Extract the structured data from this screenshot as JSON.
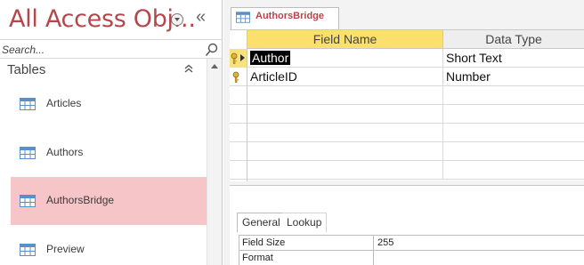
{
  "nav": {
    "title": "All Access Obj...",
    "collapse_glyph": "«",
    "search_placeholder": "Search...",
    "group_label": "Tables",
    "group_chevron": "⌃⌃",
    "items": [
      {
        "label": "Articles",
        "icon": "table-icon",
        "selected": false
      },
      {
        "label": "Authors",
        "icon": "table-icon",
        "selected": false
      },
      {
        "label": "AuthorsBridge",
        "icon": "table-icon",
        "selected": true
      },
      {
        "label": "Preview",
        "icon": "table-icon",
        "selected": false
      }
    ]
  },
  "tab": {
    "label": "AuthorsBridge",
    "icon": "table-icon"
  },
  "design_grid": {
    "headers": {
      "field_name": "Field Name",
      "data_type": "Data Type"
    },
    "rows": [
      {
        "field_name": "Author",
        "data_type": "Short Text",
        "primary_key": true,
        "current": true
      },
      {
        "field_name": "ArticleID",
        "data_type": "Number",
        "primary_key": true,
        "current": false
      }
    ]
  },
  "properties": {
    "tabs": [
      "General",
      "Lookup"
    ],
    "active_tab": "General",
    "rows": [
      {
        "name": "Field Size",
        "value": "255"
      },
      {
        "name": "Format",
        "value": ""
      }
    ]
  },
  "colors": {
    "accent": "#b5474a",
    "selected_item": "#f5c5c7",
    "header_highlight": "#fbe06b"
  }
}
